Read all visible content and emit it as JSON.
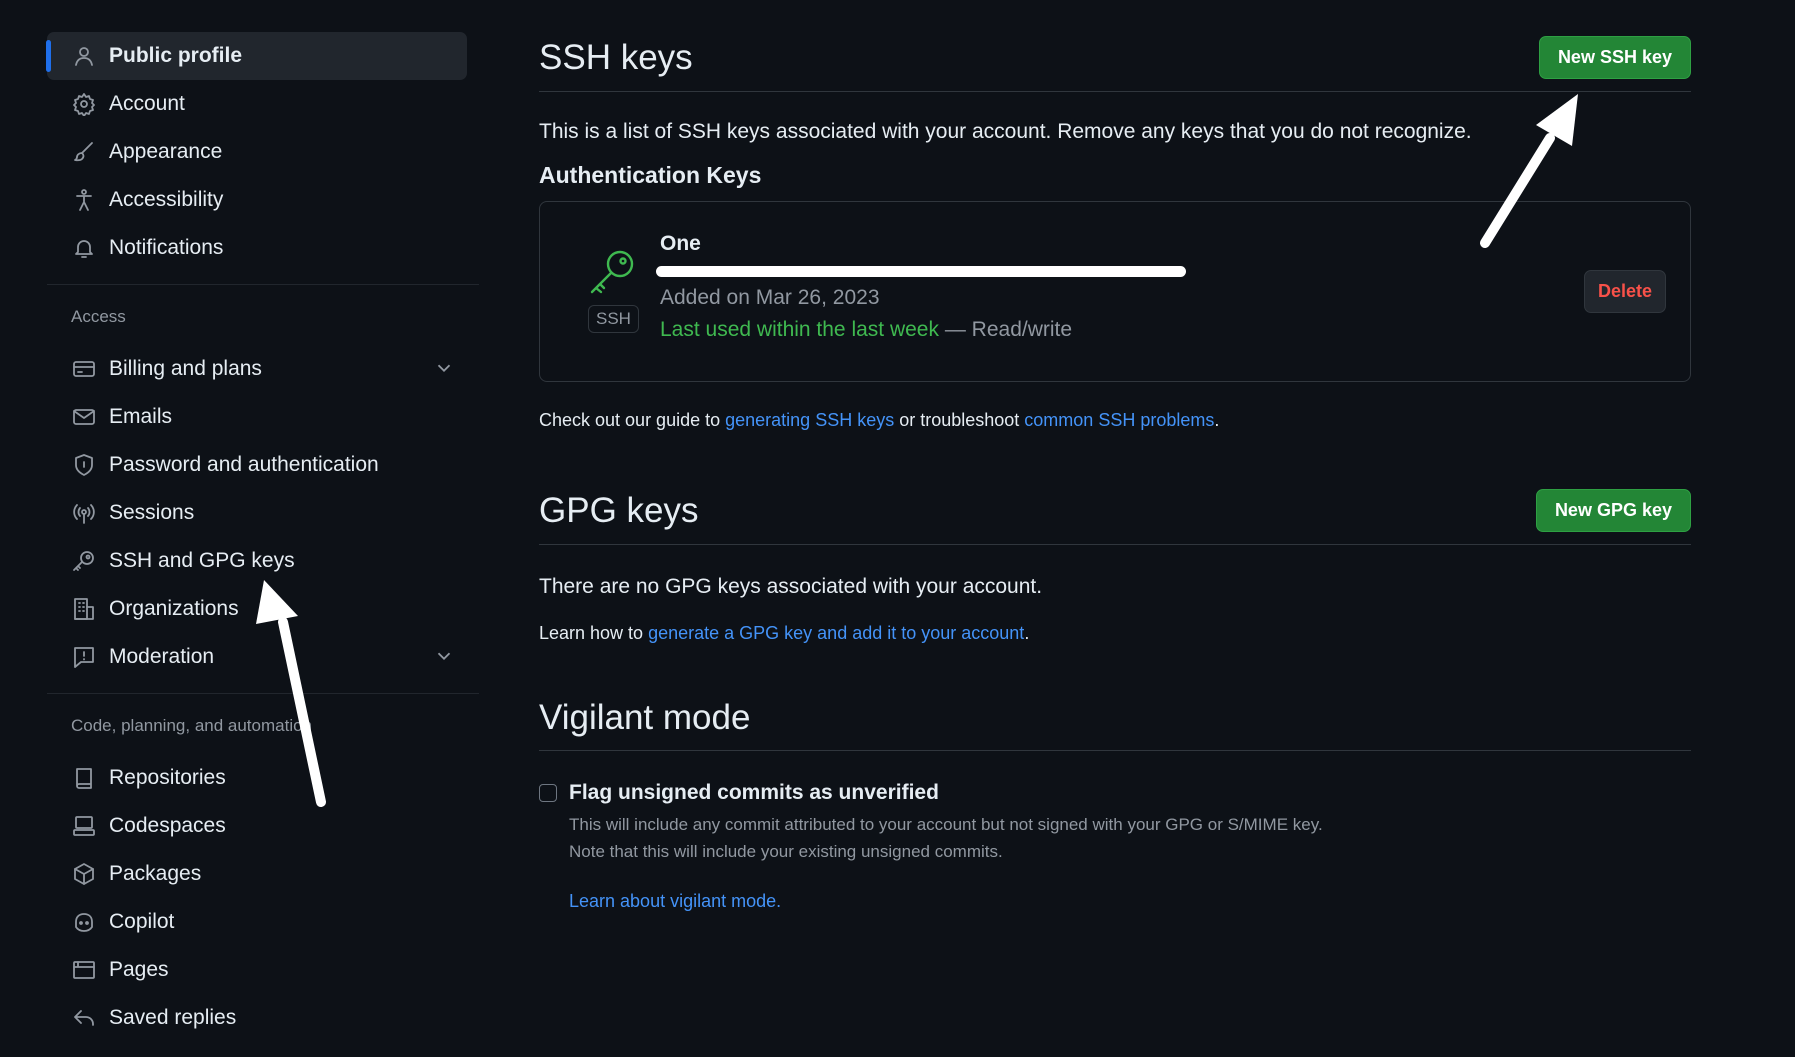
{
  "sidebar": {
    "items_top": [
      {
        "label": "Public profile",
        "icon": "person-icon"
      },
      {
        "label": "Account",
        "icon": "gear-icon"
      },
      {
        "label": "Appearance",
        "icon": "paintbrush-icon"
      },
      {
        "label": "Accessibility",
        "icon": "accessibility-icon"
      },
      {
        "label": "Notifications",
        "icon": "bell-icon"
      }
    ],
    "access_label": "Access",
    "items_access": [
      {
        "label": "Billing and plans",
        "icon": "credit-card-icon"
      },
      {
        "label": "Emails",
        "icon": "mail-icon"
      },
      {
        "label": "Password and authentication",
        "icon": "shield-lock-icon"
      },
      {
        "label": "Sessions",
        "icon": "broadcast-icon"
      },
      {
        "label": "SSH and GPG keys",
        "icon": "key-icon"
      },
      {
        "label": "Organizations",
        "icon": "organization-icon"
      },
      {
        "label": "Moderation",
        "icon": "report-icon"
      }
    ],
    "code_label": "Code, planning, and automation",
    "items_code": [
      {
        "label": "Repositories",
        "icon": "repo-icon"
      },
      {
        "label": "Codespaces",
        "icon": "codespaces-icon"
      },
      {
        "label": "Packages",
        "icon": "package-icon"
      },
      {
        "label": "Copilot",
        "icon": "copilot-icon"
      },
      {
        "label": "Pages",
        "icon": "browser-icon"
      },
      {
        "label": "Saved replies",
        "icon": "reply-icon"
      }
    ]
  },
  "ssh": {
    "title": "SSH keys",
    "new_button": "New SSH key",
    "description": "This is a list of SSH keys associated with your account. Remove any keys that you do not recognize.",
    "auth_heading": "Authentication Keys",
    "key": {
      "name": "One",
      "badge": "SSH",
      "added": "Added on Mar 26, 2023",
      "last_used": "Last used within the last week",
      "access": " — Read/write",
      "delete_button": "Delete"
    },
    "guide_prefix": "Check out our guide to ",
    "guide_link1": "generating SSH keys",
    "guide_middle": " or troubleshoot ",
    "guide_link2": "common SSH problems",
    "guide_suffix": "."
  },
  "gpg": {
    "title": "GPG keys",
    "new_button": "New GPG key",
    "empty_text": "There are no GPG keys associated with your account.",
    "learn_prefix": "Learn how to ",
    "learn_link": "generate a GPG key and add it to your account",
    "learn_suffix": "."
  },
  "vigilant": {
    "title": "Vigilant mode",
    "checkbox_label": "Flag unsigned commits as unverified",
    "checkbox_checked": false,
    "note_line1": "This will include any commit attributed to your account but not signed with your GPG or S/MIME key.",
    "note_line2": "Note that this will include your existing unsigned commits.",
    "learn_link": "Learn about vigilant mode."
  },
  "colors": {
    "background": "#0d1117",
    "accent_green": "#238636",
    "link_blue": "#4493f8",
    "danger_red": "#f85149",
    "active_indicator": "#1f6feb"
  }
}
